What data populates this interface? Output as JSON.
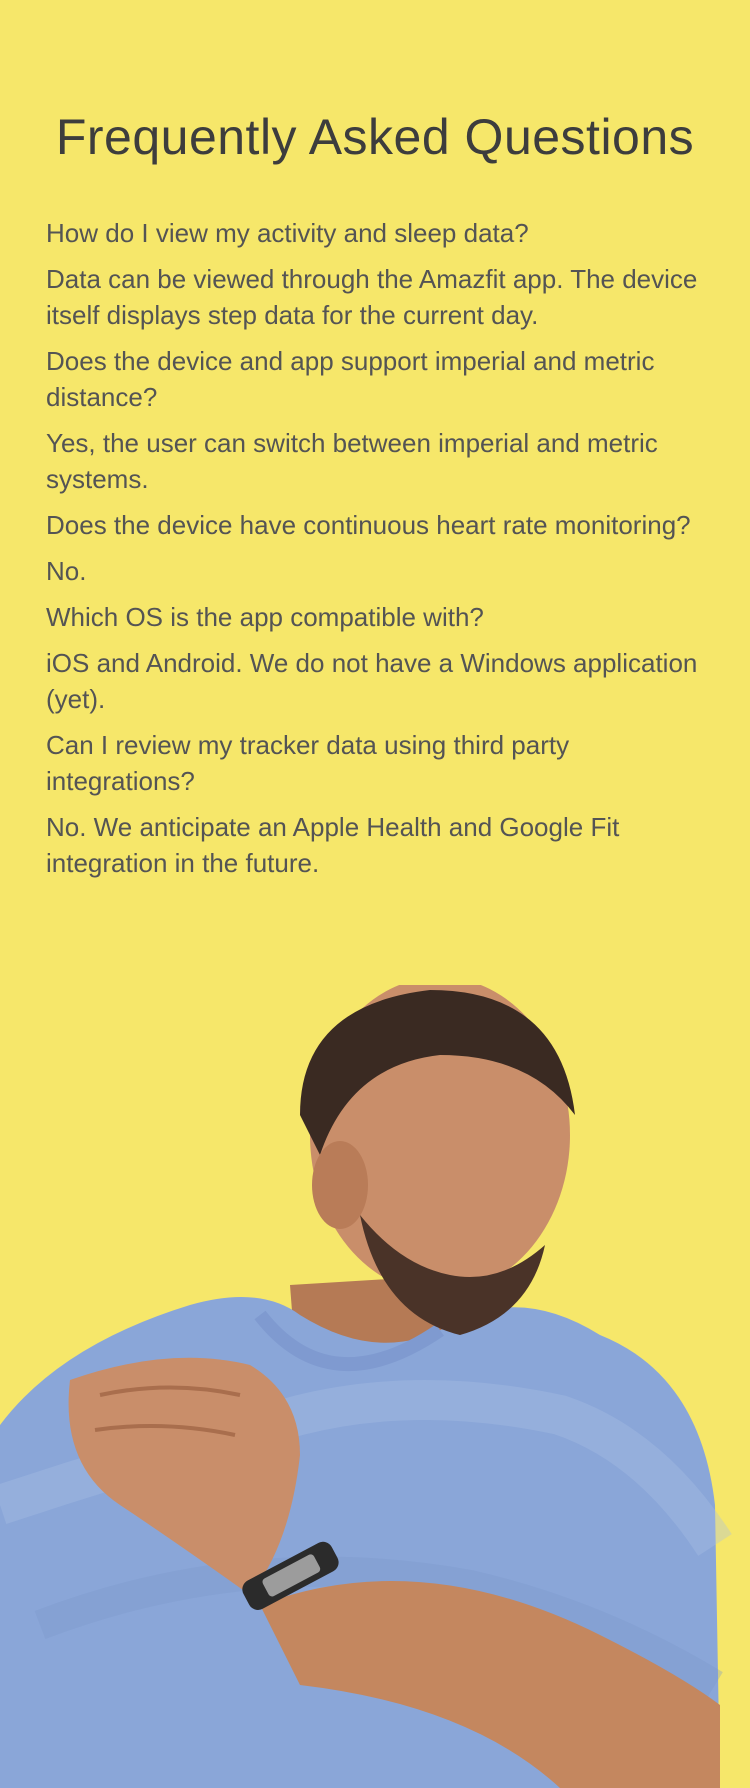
{
  "title": "Frequently Asked Questions",
  "faq": [
    {
      "question": "How do I view my activity and sleep data?",
      "answer": "Data can be viewed through the Amazfit app. The device itself displays step data for the current day."
    },
    {
      "question": "Does the device and app support imperial and metric distance?",
      "answer": "Yes, the user can switch between imperial and metric systems."
    },
    {
      "question": "Does the device have continuous heart rate monitoring?",
      "answer": "No."
    },
    {
      "question": "Which OS is the app compatible with?",
      "answer": "iOS and Android. We do not have a Windows application (yet)."
    },
    {
      "question": "Can I review my tracker data using third party integrations?",
      "answer": "No. We anticipate an Apple Health and Google Fit integration in the future."
    }
  ],
  "colors": {
    "background": "#f6e76a",
    "text": "#545454",
    "shirt": "#8aa6d8",
    "skin": "#c98e6a",
    "band": "#2b2b2b"
  }
}
